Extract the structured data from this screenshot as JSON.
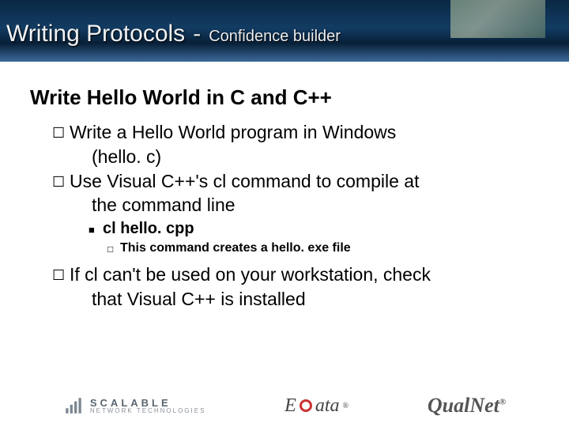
{
  "header": {
    "title": "Writing Protocols",
    "dash": "-",
    "subtitle": "Confidence builder"
  },
  "content": {
    "heading": "Write Hello World in C and C++",
    "b1_a_pre": "Write a Hello World program in Windows",
    "b1_a_cont": "(hello. c)",
    "b1_b_pre": "Use Visual C++'s ",
    "b1_b_code1": "cl",
    "b1_b_mid": " command to compile at",
    "b1_b_cont": "the command line",
    "b2": "cl hello. cpp",
    "b3": "This command creates a hello. exe file",
    "b1_c_pre": "If ",
    "b1_c_code": "cl",
    "b1_c_mid": " can't be used on your workstation, check",
    "b1_c_cont": "that Visual C++ is installed"
  },
  "footer": {
    "scalable_l1": "SCALABLE",
    "scalable_l2": "NETWORK TECHNOLOGIES",
    "exata_pre": "E",
    "exata_post": "ata",
    "exata_tm": "®",
    "qualnet": "QualNet",
    "qualnet_tm": "®"
  }
}
